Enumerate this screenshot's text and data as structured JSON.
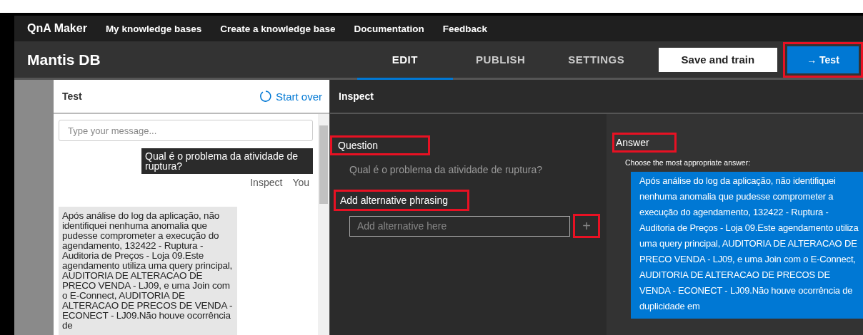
{
  "top_nav": {
    "brand": "QnA Maker",
    "links": [
      "My knowledge bases",
      "Create a knowledge base",
      "Documentation",
      "Feedback"
    ]
  },
  "header": {
    "title": "Mantis DB",
    "tabs": [
      {
        "label": "EDIT",
        "selected": true
      },
      {
        "label": "PUBLISH",
        "selected": false
      },
      {
        "label": "SETTINGS",
        "selected": false
      }
    ],
    "save_button": "Save and train",
    "test_button": {
      "icon": "→",
      "label": "Test",
      "highlighted": true
    }
  },
  "test_panel": {
    "title": "Test",
    "start_over": "Start over",
    "message_field": {
      "placeholder": "Type your message..."
    },
    "messages": [
      {
        "kind": "user",
        "text": "Qual é o problema da atividade de ruptura?",
        "links": [
          "Inspect",
          "You"
        ]
      },
      {
        "kind": "bot",
        "text": "Após análise do log da aplicação, não identifiquei nenhuma anomalia que pudesse comprometer a execução do agendamento, 132422 - Ruptura - Auditoria de Preços - Loja 09.Este agendamento utiliza uma query principal, AUDITORIA DE ALTERACAO DE PRECO VENDA - LJ09, e uma Join com o E-Connect, AUDITORIA DE ALTERACAO DE PRECOS DE VENDA - ECONECT - LJ09.Não houve ocorrência de"
      }
    ]
  },
  "inspect_panel": {
    "title": "Inspect",
    "question": {
      "label": "Question",
      "highlighted": true,
      "text": "Qual é o problema da atividade de ruptura?"
    },
    "alternative": {
      "label": "Add alternative phrasing",
      "highlighted": true,
      "placeholder": "Add alternative here",
      "add_button": {
        "icon": "+",
        "highlighted": true
      }
    },
    "answer": {
      "label": "Answer",
      "highlighted": true,
      "hint": "Choose the most appropriate answer:",
      "text": "Após análise do log da aplicação, não identifiquei nenhuma anomalia que pudesse comprometer a execução do agendamento, 132422 - Ruptura - Auditoria de Preços - Loja 09.Este agendamento utiliza uma query principal, AUDITORIA DE ALTERACAO DE PRECO VENDA - LJ09, e uma Join com o E-Connect, AUDITORIA DE ALTERACAO DE PRECOS DE VENDA - ECONECT - LJ09.Não houve ocorrência de duplicidade em"
    }
  }
}
